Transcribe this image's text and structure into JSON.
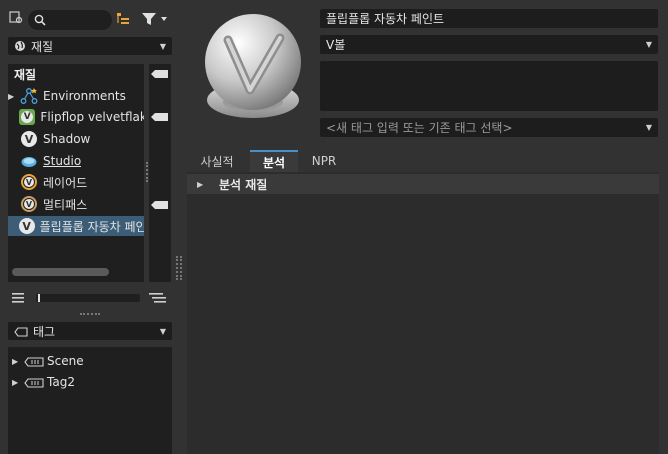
{
  "toolbar": {
    "search_placeholder": ""
  },
  "library_dropdown": {
    "label": "재질"
  },
  "tree": {
    "header": "재질",
    "items": [
      {
        "label": "Environments",
        "expandable": true
      },
      {
        "label": "Flipflop velvetflake",
        "expandable": false
      },
      {
        "label": "Shadow",
        "expandable": false
      },
      {
        "label": "Studio",
        "expandable": false
      },
      {
        "label": "레이어드",
        "expandable": false
      },
      {
        "label": "멀티패스",
        "expandable": false
      },
      {
        "label": "플립플롭 자동차 페인트",
        "expandable": false,
        "selected": true
      }
    ]
  },
  "tag_dropdown": {
    "label": "태그"
  },
  "tags": [
    {
      "label": "Scene"
    },
    {
      "label": "Tag2"
    }
  ],
  "material": {
    "name": "플립플롭 자동차 페인트",
    "shader_type": "V볼",
    "tag_placeholder": "<새 태그 입력 또는 기존 태그 선택>"
  },
  "tabs": [
    {
      "label": "사실적",
      "active": false
    },
    {
      "label": "분석",
      "active": true
    },
    {
      "label": "NPR",
      "active": false
    }
  ],
  "section": {
    "label": "분석 재질"
  },
  "colors": {
    "accent": "#3c5d78",
    "vball": "#e8e8e8"
  }
}
